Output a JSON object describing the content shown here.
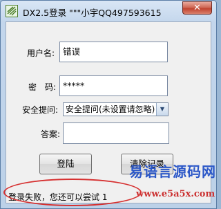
{
  "window": {
    "title": "DX2.5登录 \"\"\"小宇QQ497593615",
    "close_glyph": "✕",
    "icon": "app-icon"
  },
  "form": {
    "username_label": "用户名:",
    "username_value": "错误",
    "password_label": "密　码:",
    "password_value": "*****",
    "question_label": "安全提问:",
    "question_value": "安全提问(未设置请忽略)",
    "answer_label": "答案:",
    "answer_value": "",
    "login_button": "登陆",
    "clear_button": "清除记录"
  },
  "status": {
    "text": "登录失败，您还可以尝试 1"
  },
  "watermark": {
    "text": "易语言源码网",
    "url": "www.e5a5x.com"
  },
  "colors": {
    "accent": "#2c58c8",
    "annotation": "#d63030"
  }
}
